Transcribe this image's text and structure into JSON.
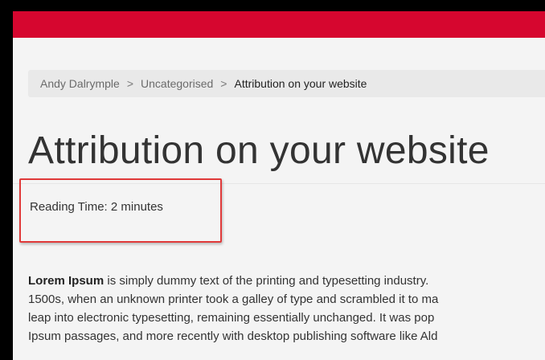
{
  "colors": {
    "header": "#d6062f",
    "frame": "#000000",
    "page_bg": "#f4f4f4",
    "breadcrumb_bg": "#e9e9e9",
    "annotation_box": "#e03a3a"
  },
  "breadcrumb": {
    "home": "Andy Dalrymple",
    "separator": ">",
    "category": "Uncategorised",
    "current": "Attribution on your website"
  },
  "post": {
    "title": "Attribution on your website",
    "reading_time": "Reading Time: 2 minutes",
    "body": {
      "lead_bold": "Lorem Ipsum",
      "line1_rest": " is simply dummy text of the printing and typesetting industry. ",
      "line2": "1500s, when an unknown printer took a galley of type and scrambled it to ma",
      "line3": "leap into electronic typesetting, remaining essentially unchanged. It was pop",
      "line4": "Ipsum passages, and more recently with desktop publishing software like Ald"
    }
  }
}
